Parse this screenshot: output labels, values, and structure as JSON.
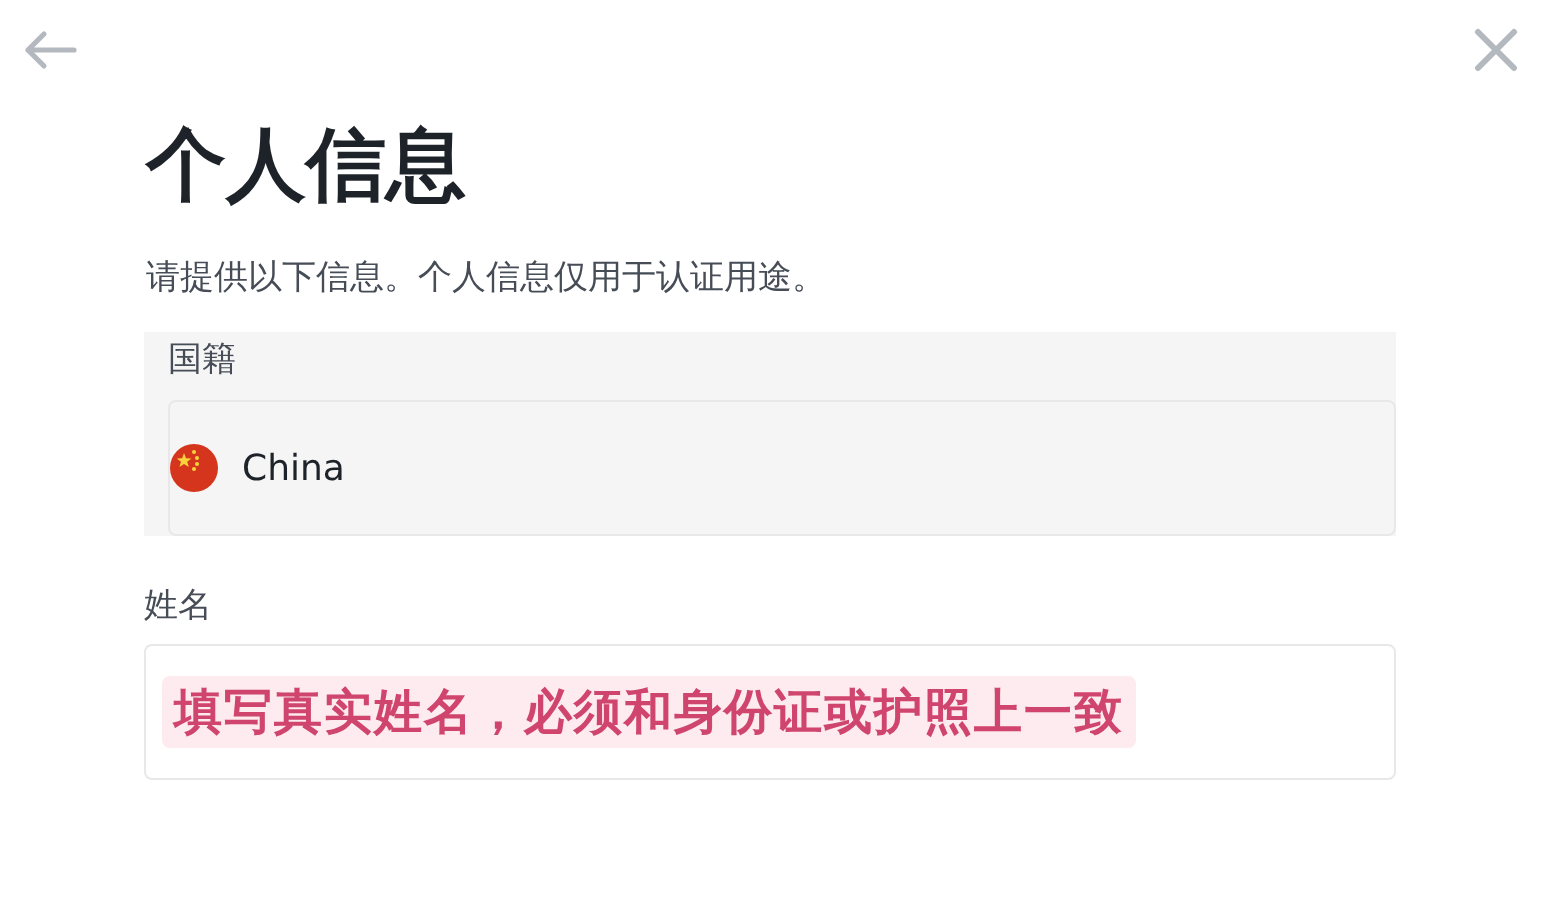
{
  "title": "个人信息",
  "description": "请提供以下信息。个人信息仅用于认证用途。",
  "nationality": {
    "label": "国籍",
    "value": "China",
    "disabled": true
  },
  "name_field": {
    "label": "姓名",
    "annotation": "填写真实姓名，必须和身份证或护照上一致"
  }
}
